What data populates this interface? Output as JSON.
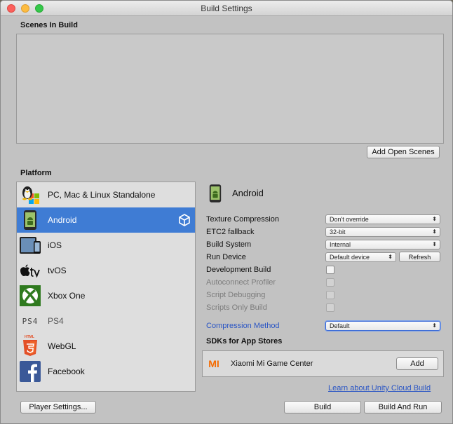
{
  "window": {
    "title": "Build Settings"
  },
  "scenes": {
    "title": "Scenes In Build",
    "add_open_scenes_label": "Add Open Scenes"
  },
  "platform": {
    "title": "Platform",
    "items": [
      {
        "label": "PC, Mac & Linux Standalone",
        "icon": "pc-mac-linux-icon"
      },
      {
        "label": "Android",
        "icon": "android-icon",
        "selected": true
      },
      {
        "label": "iOS",
        "icon": "ios-icon"
      },
      {
        "label": "tvOS",
        "icon": "apple-tv-icon"
      },
      {
        "label": "Xbox One",
        "icon": "xbox-icon"
      },
      {
        "label": "PS4",
        "icon": "ps4-icon",
        "logo_text": "PS4"
      },
      {
        "label": "WebGL",
        "icon": "html5-icon",
        "logo_text": "HTML"
      },
      {
        "label": "Facebook",
        "icon": "facebook-icon"
      }
    ]
  },
  "settings": {
    "platform_title": "Android",
    "texture_compression": {
      "label": "Texture Compression",
      "value": "Don't override"
    },
    "etc2_fallback": {
      "label": "ETC2 fallback",
      "value": "32-bit"
    },
    "build_system": {
      "label": "Build System",
      "value": "Internal"
    },
    "run_device": {
      "label": "Run Device",
      "value": "Default device",
      "refresh_label": "Refresh"
    },
    "development_build": {
      "label": "Development Build"
    },
    "autoconnect_profiler": {
      "label": "Autoconnect Profiler"
    },
    "script_debugging": {
      "label": "Script Debugging"
    },
    "scripts_only_build": {
      "label": "Scripts Only Build"
    },
    "compression_method": {
      "label": "Compression Method",
      "value": "Default"
    }
  },
  "sdks": {
    "title": "SDKs for App Stores",
    "items": [
      {
        "label": "Xiaomi Mi Game Center",
        "add_label": "Add",
        "logo_text": "MI"
      }
    ]
  },
  "footer": {
    "cloud_build_link": "Learn about Unity Cloud Build",
    "player_settings_label": "Player Settings...",
    "build_label": "Build",
    "build_and_run_label": "Build And Run"
  },
  "colors": {
    "selection": "#3f7cd4",
    "link": "#2a55c4",
    "window_bg": "#c2c2c2"
  }
}
